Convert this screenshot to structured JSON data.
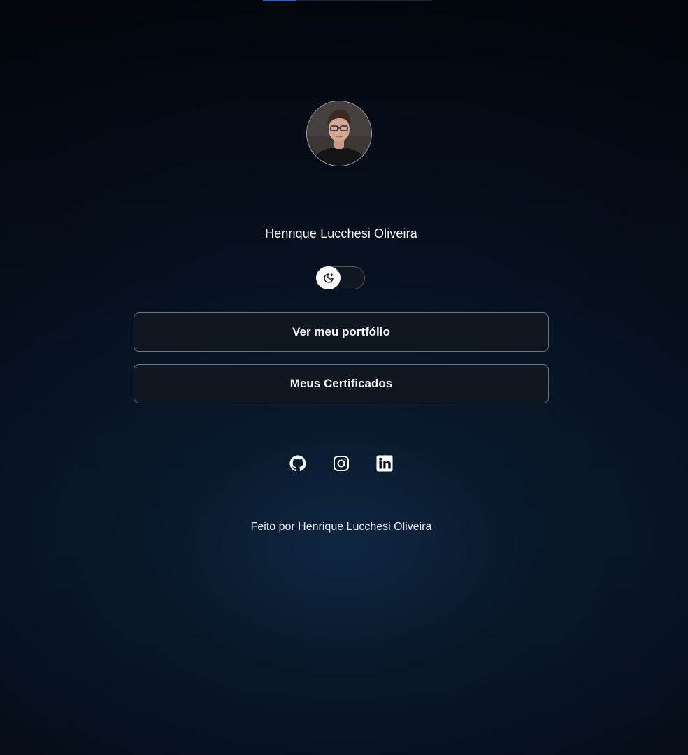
{
  "loading_bar": {
    "progress": 0.2
  },
  "profile": {
    "name": "Henrique Lucchesi Oliveira",
    "avatar_icon": "profile-photo"
  },
  "theme_toggle": {
    "icon": "moon-stars-icon",
    "state": "dark"
  },
  "links": [
    {
      "label": "Ver meu portfólio"
    },
    {
      "label": "Meus Certificados"
    }
  ],
  "socials": [
    {
      "icon": "github-icon"
    },
    {
      "icon": "instagram-icon"
    },
    {
      "icon": "linkedin-icon"
    }
  ],
  "footer": {
    "text": "Feito por Henrique Lucchesi Oliveira"
  },
  "colors": {
    "background": "#040a14",
    "accent": "#2563eb",
    "button_bg": "#111720",
    "button_border": "#6b7280",
    "text": "#f3f4f6"
  }
}
